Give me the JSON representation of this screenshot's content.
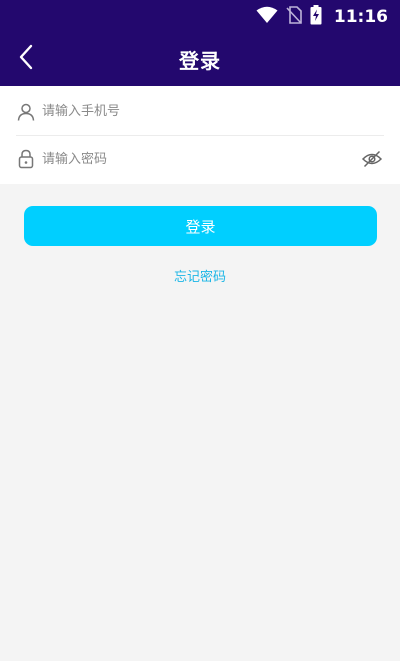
{
  "status_bar": {
    "time": "11:16",
    "icons": [
      "wifi-icon",
      "no-sim-icon",
      "battery-charging-icon"
    ]
  },
  "header": {
    "title": "登录",
    "back_icon": "chevron-left-icon"
  },
  "form": {
    "phone_placeholder": "请输入手机号",
    "phone_value": "",
    "phone_icon": "user-icon",
    "password_placeholder": "请输入密码",
    "password_value": "",
    "password_icon": "lock-icon",
    "visibility_icon": "eye-off-icon"
  },
  "actions": {
    "login_label": "登录",
    "forgot_label": "忘记密码"
  },
  "colors": {
    "header_bg": "#23086e",
    "button_bg": "#00cfff",
    "link": "#1bb6e6",
    "page_bg": "#f4f4f4"
  }
}
